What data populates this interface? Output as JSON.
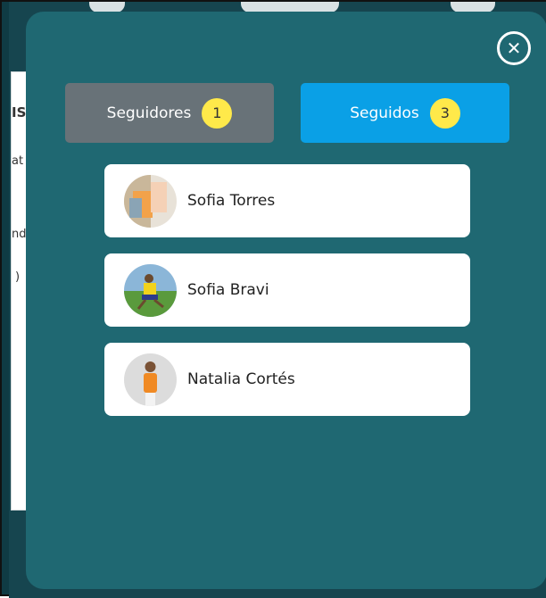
{
  "modal": {
    "close_icon": "close-circle-icon",
    "tabs": [
      {
        "label": "Seguidores",
        "count": "1"
      },
      {
        "label": "Seguidos",
        "count": "3"
      }
    ],
    "users": [
      {
        "name": "Sofia Torres",
        "avatar": "avatar-photo-icon"
      },
      {
        "name": "Sofia Bravi",
        "avatar": "avatar-photo-icon"
      },
      {
        "name": "Natalia Cortés",
        "avatar": "avatar-photo-icon"
      }
    ]
  },
  "background": {
    "fragments": [
      "IS",
      "at",
      "ndi",
      ")"
    ]
  },
  "colors": {
    "modal_bg": "#1f6872",
    "active_tab": "#0aa0e6",
    "inactive_tab": "#687278",
    "badge": "#ffe94a"
  }
}
